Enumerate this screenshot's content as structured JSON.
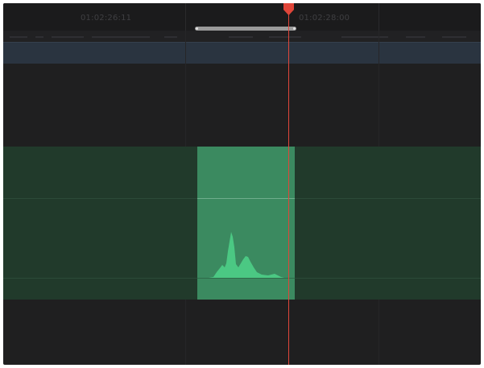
{
  "timeline": {
    "timecodes": [
      "01:02:26:11",
      "01:02:28:00"
    ],
    "colors": {
      "background": "#1f1f20",
      "video_track": "#2a3440",
      "audio_track": "#213a2b",
      "audio_clip": "#3b8a60",
      "waveform": "#4fd28a",
      "playhead": "#e0463a"
    }
  },
  "icons": {
    "playhead": "playhead-marker-icon"
  }
}
